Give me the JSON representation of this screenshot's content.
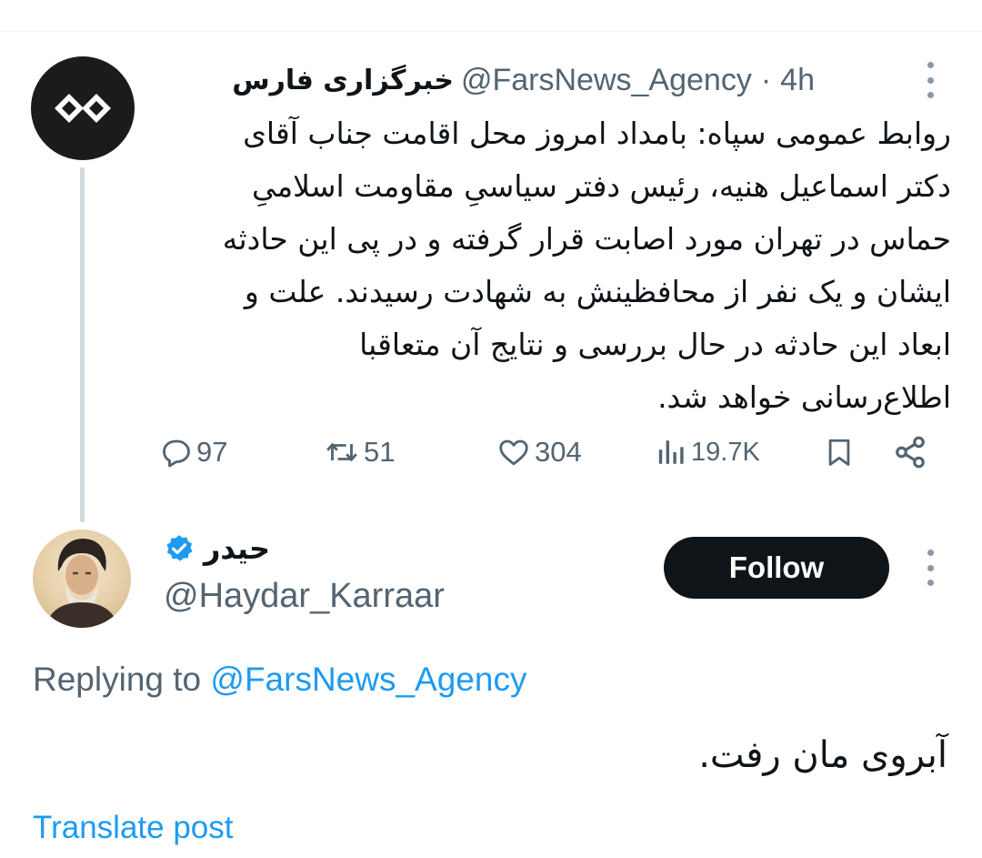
{
  "parent_tweet": {
    "author_name": "خبرگزاری فارس",
    "handle": "@FarsNews_Agency",
    "separator": "·",
    "time": "4h",
    "text_lines": [
      "روابط عمومی سپاه: بامداد امروز محل اقامت جناب آقای",
      "دکتر اسماعیل هنیه، رئیس دفتر سیاسیِ مقاومت اسلامیِ",
      "حماس در تهران مورد اصابت قرار گرفته و در پی این حادثه",
      "ایشان و یک نفر از محافظینش به شهادت رسیدند. علت و",
      "ابعاد این حادثه در حال بررسی و نتایج آن متعاقبا",
      "اطلاع‌رسانی خواهد شد."
    ],
    "stats": {
      "replies": "97",
      "reposts": "51",
      "likes": "304",
      "views": "19.7K"
    }
  },
  "reply_tweet": {
    "author_name": "حیدر",
    "handle": "@Haydar_Karraar",
    "follow_label": "Follow",
    "replying_prefix": "Replying to",
    "replying_handle": "@FarsNews_Agency",
    "text": "آبروی مان رفت.",
    "translate_label": "Translate post"
  },
  "icons": {
    "avatar_fars": "fars-logo-icon",
    "more": "more-vertical-icon",
    "reply": "reply-icon",
    "repost": "repost-icon",
    "like": "heart-icon",
    "views": "views-icon",
    "bookmark": "bookmark-icon",
    "share": "share-icon",
    "verified": "verified-badge-icon"
  },
  "colors": {
    "text_primary": "#0f1419",
    "text_secondary": "#536471",
    "link": "#1d9bf0",
    "verified": "#1d9bf0",
    "follow_bg": "#0f1419",
    "thread_line": "#cfd9de"
  }
}
